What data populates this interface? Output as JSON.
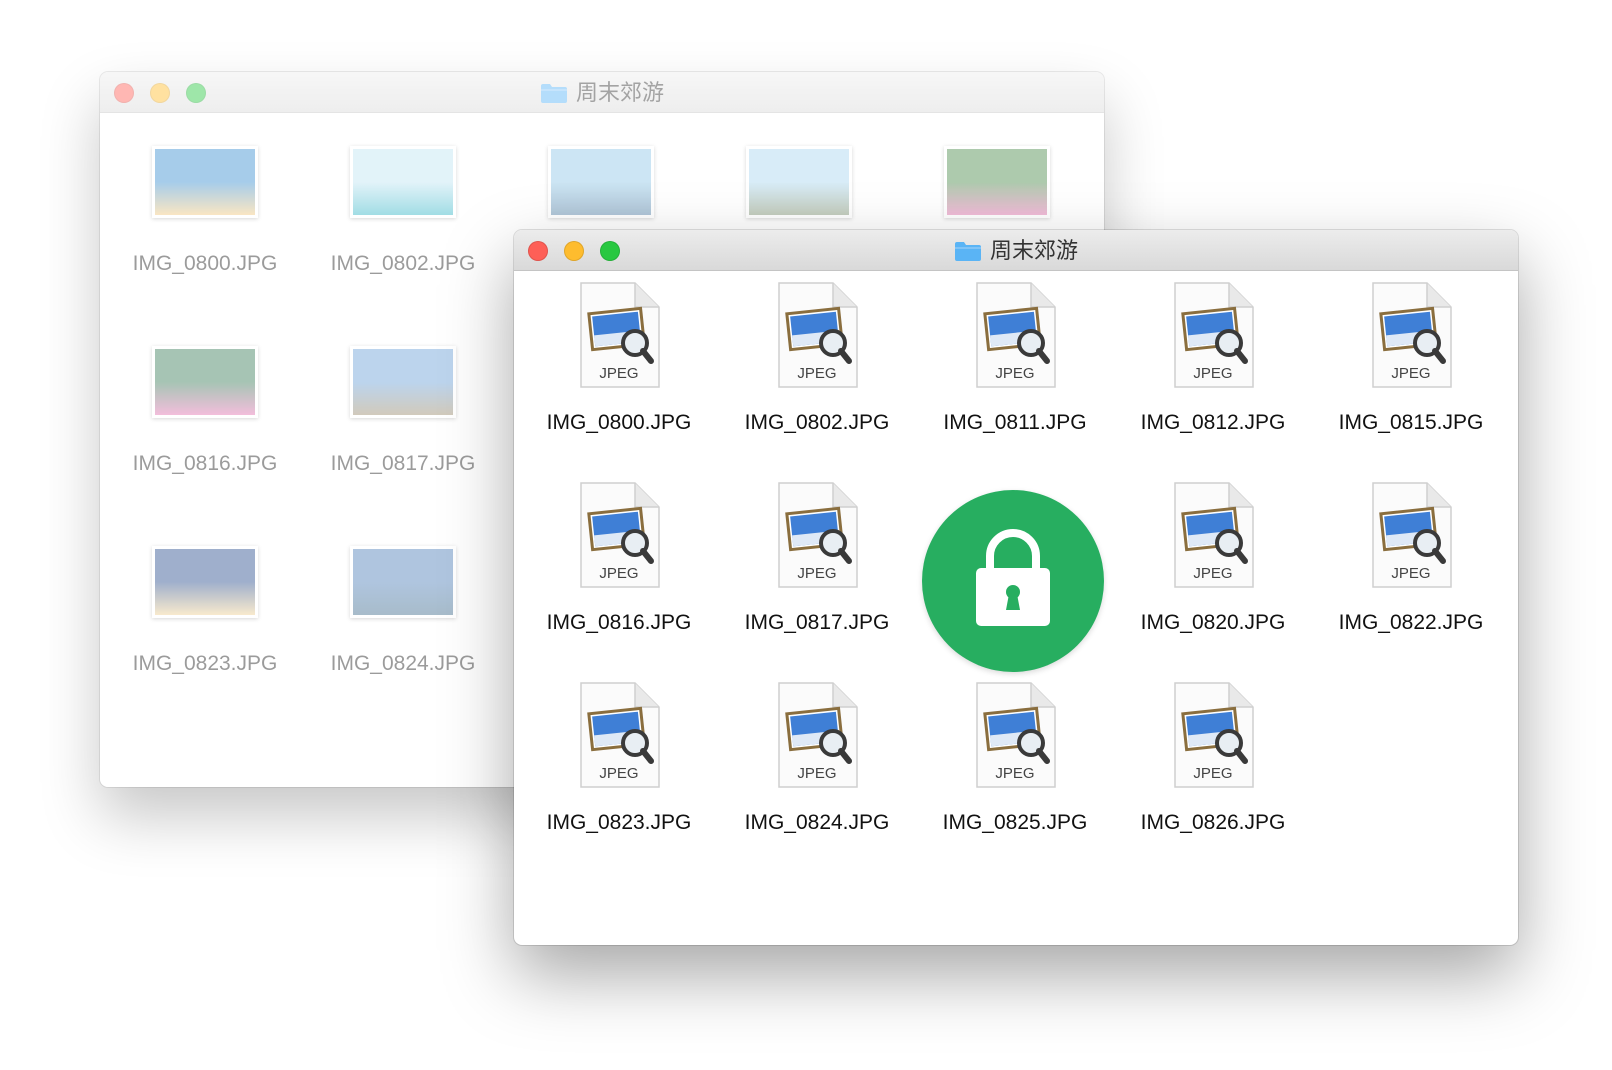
{
  "back_window": {
    "title": "周末郊游",
    "photos": [
      {
        "name": "IMG_0800.JPG",
        "colors": [
          "#3a8fd1",
          "#f2c77a"
        ]
      },
      {
        "name": "IMG_0802.JPG",
        "colors": [
          "#bfe4f2",
          "#2fb3c4"
        ]
      },
      {
        "name": "IMG_0811.JPG",
        "colors": [
          "#8fc6e6",
          "#4f7fa6"
        ]
      },
      {
        "name": "IMG_0812.JPG",
        "colors": [
          "#a9d6f0",
          "#7b8f6e"
        ]
      },
      {
        "name": "IMG_0815.JPG",
        "colors": [
          "#4a8a4a",
          "#e06aa8"
        ]
      },
      {
        "name": "IMG_0816.JPG",
        "colors": [
          "#3b7d5a",
          "#e36fb0"
        ]
      },
      {
        "name": "IMG_0817.JPG",
        "colors": [
          "#6aa0d8",
          "#9a8a6a"
        ]
      },
      {
        "name": "IMG_0823.JPG",
        "colors": [
          "#2c4f8f",
          "#f0d090"
        ]
      },
      {
        "name": "IMG_0824.JPG",
        "colors": [
          "#4f7fb8",
          "#3d6a8a"
        ]
      }
    ]
  },
  "front_window": {
    "title": "周末郊游",
    "file_type_label": "JPEG",
    "files": [
      {
        "name": "IMG_0800.JPG"
      },
      {
        "name": "IMG_0802.JPG"
      },
      {
        "name": "IMG_0811.JPG"
      },
      {
        "name": "IMG_0812.JPG"
      },
      {
        "name": "IMG_0815.JPG"
      },
      {
        "name": "IMG_0816.JPG"
      },
      {
        "name": "IMG_0817.JPG"
      },
      {
        "name": "IMG_0820.JPG"
      },
      {
        "name": "IMG_0822.JPG"
      },
      {
        "name": "IMG_0823.JPG"
      },
      {
        "name": "IMG_0824.JPG"
      },
      {
        "name": "IMG_0825.JPG"
      },
      {
        "name": "IMG_0826.JPG"
      }
    ]
  },
  "lock_overlay": {
    "icon": "lock-icon",
    "color": "#27ae60"
  },
  "colors": {
    "close": "#fe5f57",
    "minimize": "#febc2e",
    "zoom": "#28c840",
    "folder": "#5ab4f5"
  }
}
